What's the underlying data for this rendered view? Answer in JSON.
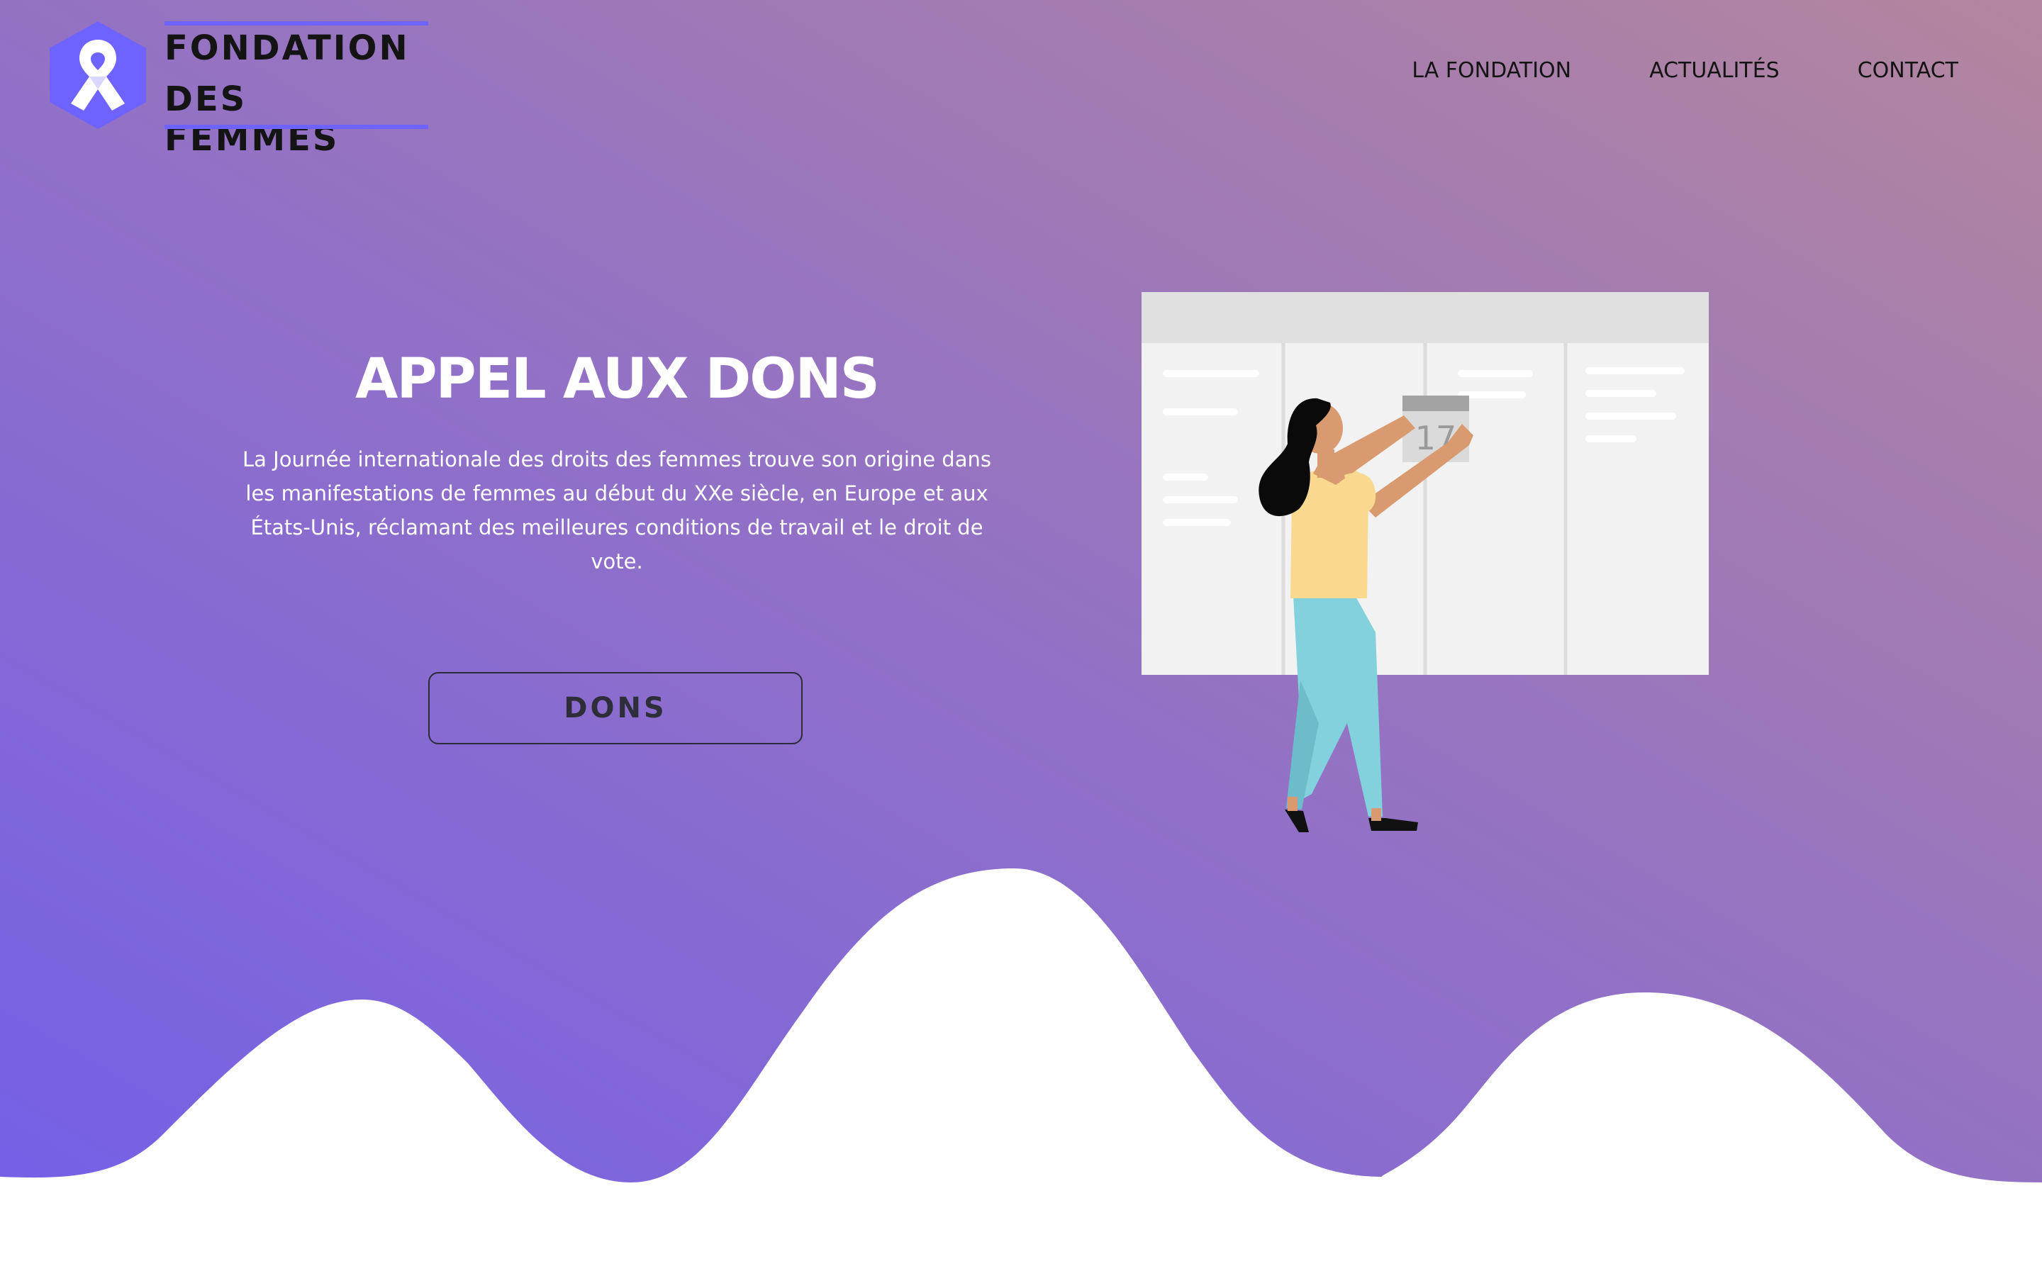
{
  "brand": {
    "name_line1": "FONDATION",
    "name_line2": "DES FEMMES",
    "logo_icon": "ribbon-icon"
  },
  "nav": {
    "items": [
      {
        "label": "LA FONDATION"
      },
      {
        "label": "ACTUALITÉS"
      },
      {
        "label": "CONTACT"
      }
    ]
  },
  "hero": {
    "title": "APPEL AUX DONS",
    "description": "La Journée internationale des droits des femmes trouve son origine dans les manifestations de femmes au début du XXe siècle, en Europe et aux États-Unis, réclamant des meilleures conditions de travail et le droit de vote.",
    "cta_label": "DONS"
  },
  "illustration": {
    "calendar_day": "17",
    "subject": "woman-pinning-calendar-illustration"
  },
  "colors": {
    "gradient_start": "#7560e6",
    "gradient_end": "#b3869e",
    "logo_accent": "#6f63ff",
    "text_dark": "#141414",
    "white": "#ffffff"
  }
}
